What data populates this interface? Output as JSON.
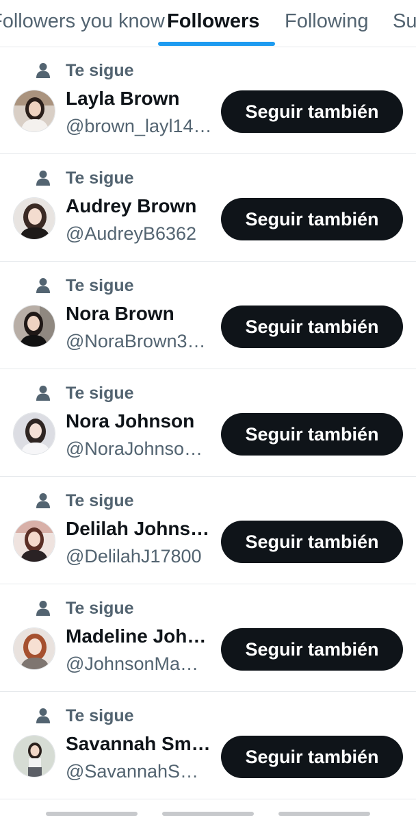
{
  "tabs": [
    {
      "label": "Followers you know",
      "active": false
    },
    {
      "label": "Followers",
      "active": true
    },
    {
      "label": "Following",
      "active": false
    },
    {
      "label": "Su",
      "active": false
    }
  ],
  "accent_color": "#1d9bf0",
  "context_icon": "person-icon",
  "follow_button_color": "#0f1419",
  "rows": [
    {
      "context": "Te sigue",
      "name": "Layla Brown",
      "handle": "@brown_layl14…",
      "button": "Seguir también"
    },
    {
      "context": "Te sigue",
      "name": "Audrey Brown",
      "handle": "@AudreyB6362",
      "button": "Seguir también"
    },
    {
      "context": "Te sigue",
      "name": "Nora Brown",
      "handle": "@NoraBrown3…",
      "button": "Seguir también"
    },
    {
      "context": "Te sigue",
      "name": "Nora Johnson",
      "handle": "@NoraJohnso…",
      "button": "Seguir también"
    },
    {
      "context": "Te sigue",
      "name": "Delilah Johns…",
      "handle": "@DelilahJ17800",
      "button": "Seguir también"
    },
    {
      "context": "Te sigue",
      "name": "Madeline Joh…",
      "handle": "@JohnsonMa…",
      "button": "Seguir también"
    },
    {
      "context": "Te sigue",
      "name": "Savannah Sm…",
      "handle": "@SavannahS…",
      "button": "Seguir también"
    }
  ]
}
